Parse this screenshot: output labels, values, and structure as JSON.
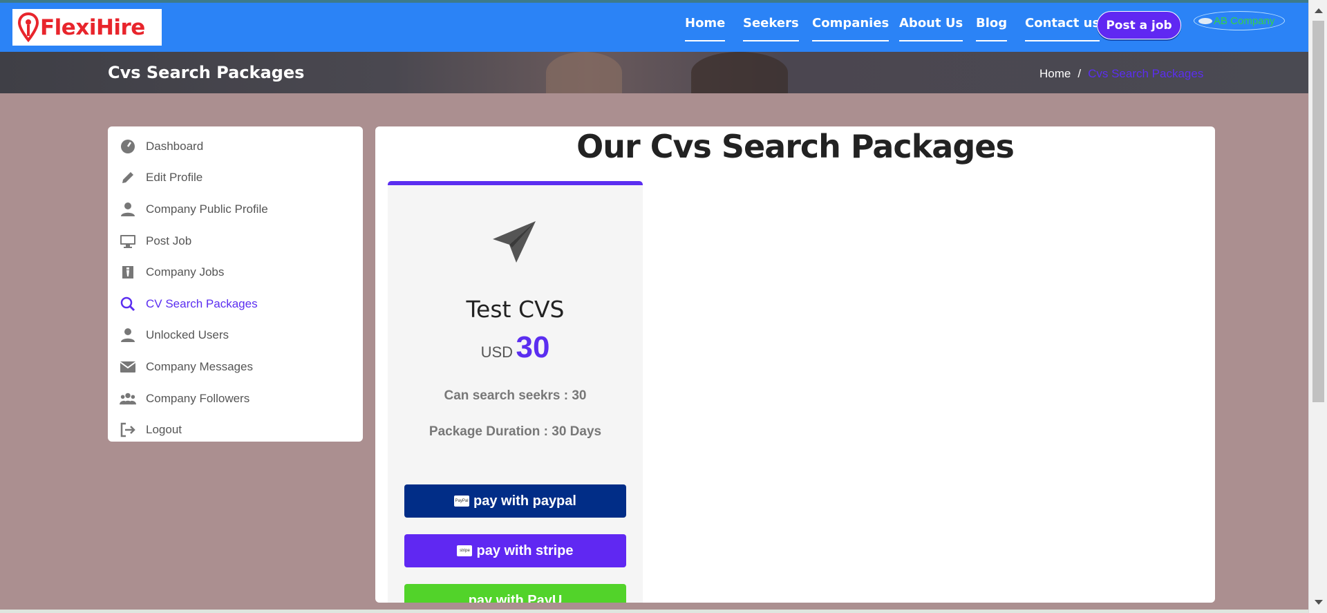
{
  "header": {
    "logo_text": "FlexiHire",
    "nav": [
      {
        "label": "Home"
      },
      {
        "label": "Seekers"
      },
      {
        "label": "Companies"
      },
      {
        "label": "About Us"
      },
      {
        "label": "Blog"
      },
      {
        "label": "Contact us"
      }
    ],
    "post_job_label": "Post a job",
    "user_name": "AB Company",
    "colors": {
      "nav_bg": "#2b83f6",
      "accent": "#6028f2"
    }
  },
  "banner": {
    "title": "Cvs Search Packages",
    "breadcrumb": {
      "home": "Home",
      "separator": "/",
      "current": "Cvs Search Packages"
    }
  },
  "sidebar": {
    "items": [
      {
        "label": "Dashboard",
        "icon": "dashboard-icon"
      },
      {
        "label": "Edit Profile",
        "icon": "pencil-icon"
      },
      {
        "label": "Company Public Profile",
        "icon": "user-icon"
      },
      {
        "label": "Post Job",
        "icon": "desktop-icon"
      },
      {
        "label": "Company Jobs",
        "icon": "briefcase-icon"
      },
      {
        "label": "CV Search Packages",
        "icon": "search-icon",
        "active": true
      },
      {
        "label": "Unlocked Users",
        "icon": "user-icon"
      },
      {
        "label": "Company Messages",
        "icon": "envelope-icon"
      },
      {
        "label": "Company Followers",
        "icon": "users-icon"
      },
      {
        "label": "Logout",
        "icon": "logout-icon"
      }
    ]
  },
  "main": {
    "title": "Our Cvs Search Packages",
    "package": {
      "icon": "paper-plane-icon",
      "name": "Test CVS",
      "currency": "USD",
      "price": "30",
      "feature_search": "Can search seekrs : 30",
      "feature_duration": "Package Duration : 30 Days",
      "paypal_label": "pay with paypal",
      "paypal_icon_text": "PayPal",
      "stripe_label": "pay with stripe",
      "stripe_icon_text": "stripe",
      "payu_label": "pay with PayU"
    }
  }
}
